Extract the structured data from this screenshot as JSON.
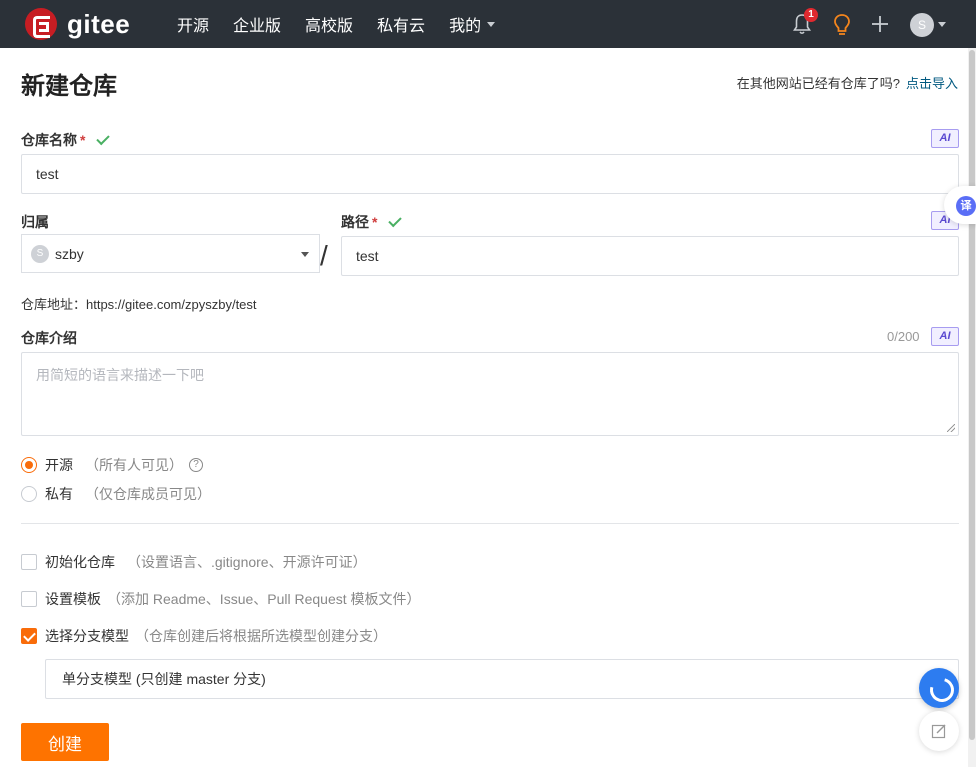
{
  "topbar": {
    "brand": "gitee",
    "nav": [
      "开源",
      "企业版",
      "高校版",
      "私有云",
      "我的"
    ],
    "notifications_count": "1",
    "avatar_letter": "S"
  },
  "page": {
    "title": "新建仓库",
    "import_hint": "在其他网站已经有仓库了吗?",
    "import_link": "点击导入"
  },
  "form": {
    "repo_name_label": "仓库名称",
    "required_mark": "*",
    "ai_label": "AI",
    "repo_name_value": "test",
    "owner_label": "归属",
    "owner_avatar": "S",
    "owner_value": "szby",
    "separator": "/",
    "path_label": "路径",
    "path_value": "test",
    "address": "仓库地址：https://gitee.com/zpyszby/test",
    "description_label": "仓库介绍",
    "description_counter": "0/200",
    "description_placeholder": "用简短的语言来描述一下吧",
    "visibility": {
      "public_label": "开源",
      "public_hint": "（所有人可见）",
      "private_label": "私有",
      "private_hint": "（仅仓库成员可见）",
      "selected": "public"
    },
    "options": [
      {
        "label": "初始化仓库",
        "hint": "（设置语言、.gitignore、开源许可证）",
        "checked": false
      },
      {
        "label": "设置模板",
        "hint": "（添加 Readme、Issue、Pull Request 模板文件）",
        "checked": false
      },
      {
        "label": "选择分支模型",
        "hint": "（仓库创建后将根据所选模型创建分支）",
        "checked": true
      }
    ],
    "branch_model_value": "单分支模型 (只创建 master 分支)",
    "create_button": "创建"
  },
  "floating": {
    "translate_label": "译"
  },
  "colors": {
    "topbar_bg": "#2b3138",
    "accent_orange": "#fe7300",
    "link_color": "#005980",
    "check_green": "#4ab063"
  }
}
